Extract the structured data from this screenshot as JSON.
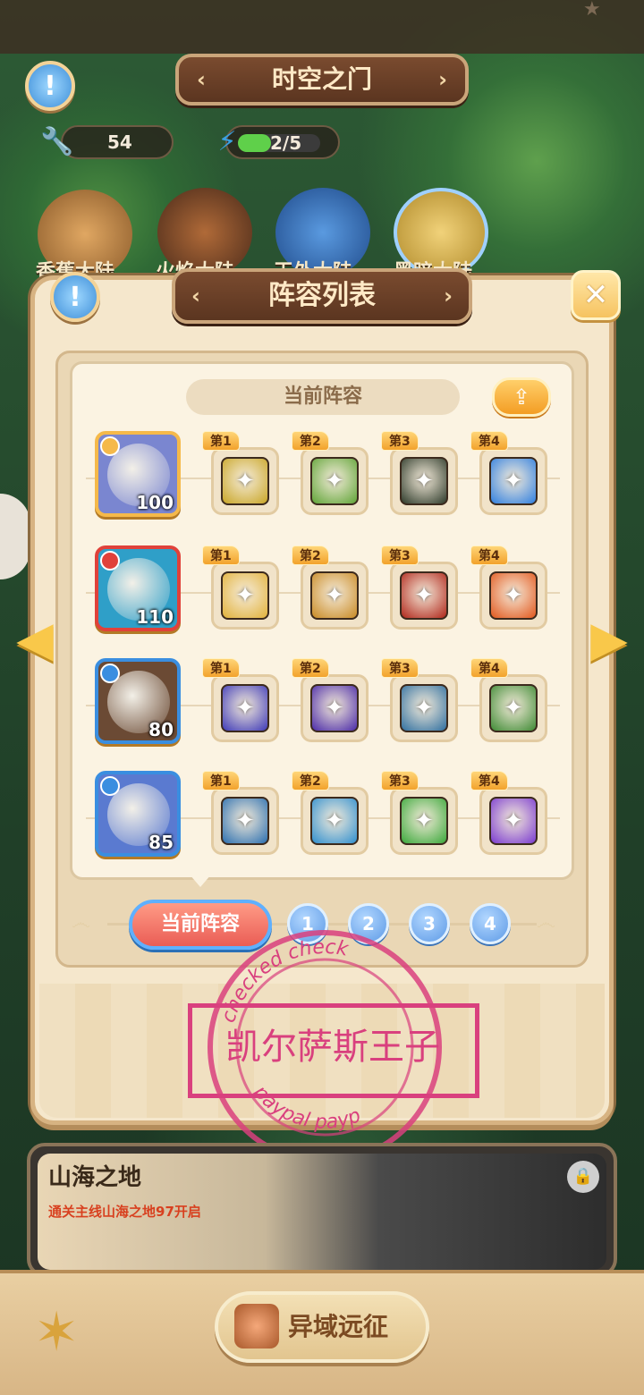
{
  "header": {
    "title": "时空之门",
    "resource_1": {
      "icon": "wrench-plus-icon",
      "value": "54"
    },
    "resource_2": {
      "icon": "energy-plus-icon",
      "value": "2/5",
      "fill_fraction": 0.4
    }
  },
  "continents": [
    {
      "label": "香蕉大陆",
      "color": "#c98a46"
    },
    {
      "label": "火焰大陆",
      "color": "#8a4a2a"
    },
    {
      "label": "天外大陆",
      "color": "#3a6fc0"
    },
    {
      "label": "黑暗大陆",
      "color": "#d9b34a"
    }
  ],
  "modal": {
    "title": "阵容列表",
    "current_lineup_label": "当前阵容",
    "share_icon": "share-icon",
    "heroes": [
      {
        "level": "100",
        "element_icon": "gear-element-icon",
        "frame_color": "#f5b94a",
        "bg": "#7a86d0",
        "skills": [
          {
            "order": "第1",
            "icon": "golden-shield-icon",
            "bg": "#c9a626"
          },
          {
            "order": "第2",
            "icon": "star-shield-icon",
            "bg": "#5fa436"
          },
          {
            "order": "第3",
            "icon": "dark-totem-icon",
            "bg": "#2d3a2a"
          },
          {
            "order": "第4",
            "icon": "blue-fist-icon",
            "bg": "#2f7fe0"
          }
        ]
      },
      {
        "level": "110",
        "element_icon": "leaf-element-icon",
        "frame_color": "#e0413a",
        "bg": "#2f9fc8",
        "skills": [
          {
            "order": "第1",
            "icon": "fist-punch-icon",
            "bg": "#e2b23a"
          },
          {
            "order": "第2",
            "icon": "golden-dragon-icon",
            "bg": "#c98a24"
          },
          {
            "order": "第3",
            "icon": "fire-eye-icon",
            "bg": "#b0261a"
          },
          {
            "order": "第4",
            "icon": "flame-beast-icon",
            "bg": "#e2571c"
          }
        ]
      },
      {
        "level": "80",
        "element_icon": "sun-element-icon",
        "frame_color": "#3a8ee0",
        "bg": "#6b4a34",
        "skills": [
          {
            "order": "第1",
            "icon": "blue-comet-icon",
            "bg": "#3e3ab8"
          },
          {
            "order": "第2",
            "icon": "purple-rain-icon",
            "bg": "#4a2aa8"
          },
          {
            "order": "第3",
            "icon": "tree-guardian-icon",
            "bg": "#2f6fa0"
          },
          {
            "order": "第4",
            "icon": "peach-plant-icon",
            "bg": "#3e8a34"
          }
        ]
      },
      {
        "level": "85",
        "element_icon": "snow-element-icon",
        "frame_color": "#3a8ee0",
        "bg": "#5a7ad0",
        "skills": [
          {
            "order": "第1",
            "icon": "red-mask-icon",
            "bg": "#2b6fb0"
          },
          {
            "order": "第2",
            "icon": "ice-trident-icon",
            "bg": "#2f8fcf"
          },
          {
            "order": "第3",
            "icon": "green-storm-icon",
            "bg": "#3aa83a"
          },
          {
            "order": "第4",
            "icon": "purple-sigil-icon",
            "bg": "#7a3ad0"
          }
        ]
      }
    ],
    "tabs": {
      "current": "当前阵容",
      "numbers": [
        "1",
        "2",
        "3",
        "4"
      ]
    }
  },
  "stamp": {
    "main_text": "凯尔萨斯王子",
    "ring_top": "checked   check",
    "ring_bottom": "paypal   payp"
  },
  "realm": {
    "title": "山海之地",
    "condition": "通关主线山海之地97开启"
  },
  "bottom": {
    "expedition_label": "异域远征"
  }
}
